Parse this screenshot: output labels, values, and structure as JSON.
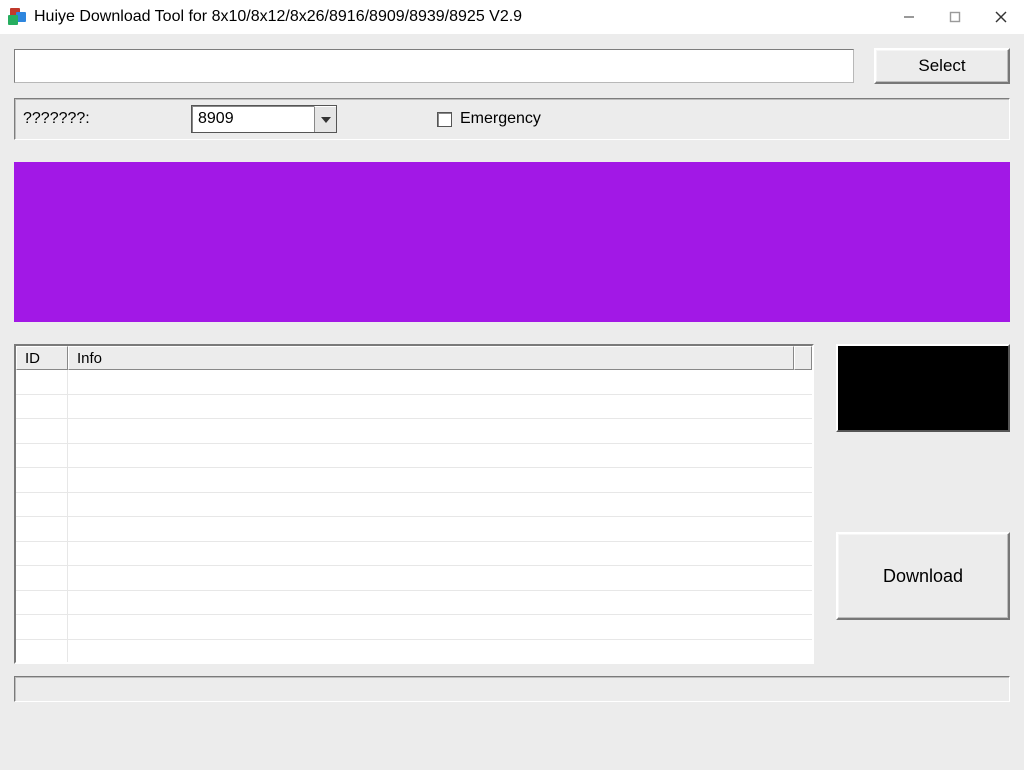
{
  "window": {
    "title": "Huiye Download Tool for 8x10/8x12/8x26/8916/8909/8939/8925 V2.9"
  },
  "toolbar": {
    "path_value": "",
    "select_label": "Select"
  },
  "config": {
    "platform_label": "???????:",
    "platform_value": "8909",
    "emergency_label": "Emergency",
    "emergency_checked": false
  },
  "panel": {
    "color": "#a218e6"
  },
  "table": {
    "columns": {
      "id": "ID",
      "info": "Info"
    },
    "rows": [
      {
        "id": "",
        "info": ""
      },
      {
        "id": "",
        "info": ""
      },
      {
        "id": "",
        "info": ""
      },
      {
        "id": "",
        "info": ""
      },
      {
        "id": "",
        "info": ""
      },
      {
        "id": "",
        "info": ""
      },
      {
        "id": "",
        "info": ""
      },
      {
        "id": "",
        "info": ""
      },
      {
        "id": "",
        "info": ""
      },
      {
        "id": "",
        "info": ""
      },
      {
        "id": "",
        "info": ""
      },
      {
        "id": "",
        "info": ""
      }
    ]
  },
  "side": {
    "black_button_label": "",
    "download_label": "Download"
  },
  "status": {
    "text": ""
  }
}
